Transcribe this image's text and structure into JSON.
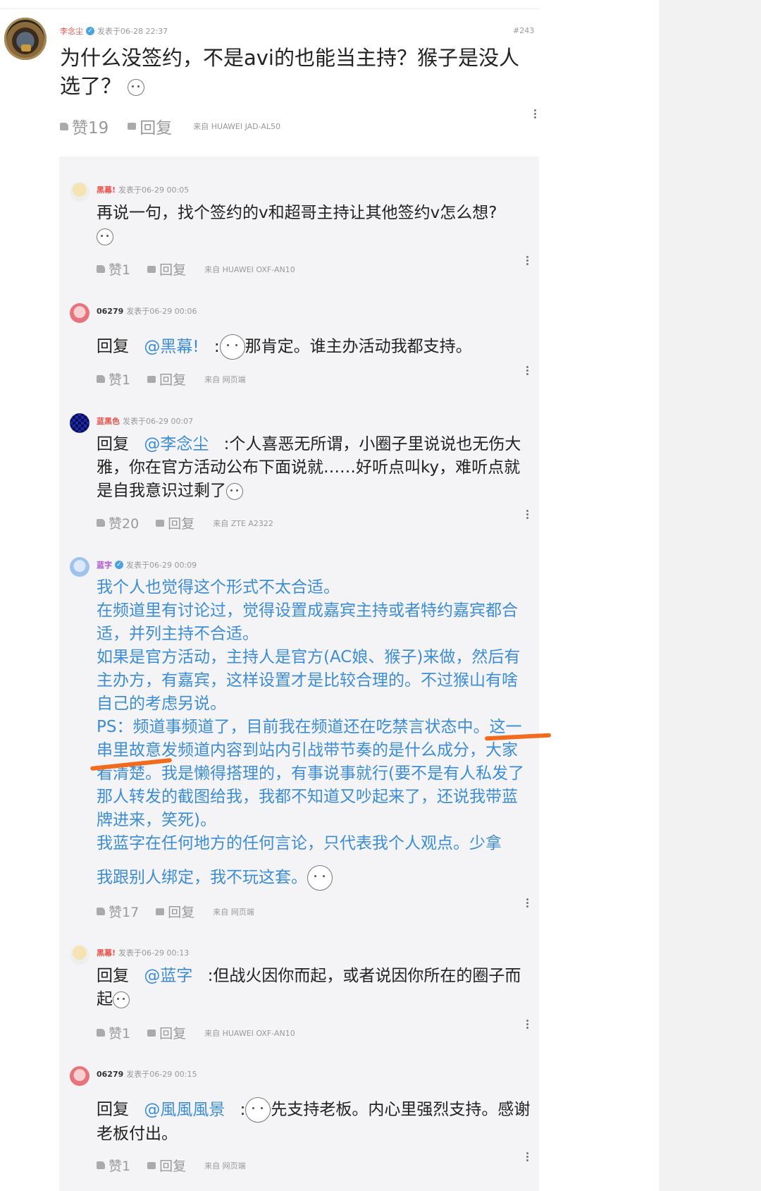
{
  "main_post": {
    "username": "李念尘",
    "time": "发表于06-28  22:37",
    "floor": "#243",
    "content": "为什么没签约，不是avi的也能当主持？猴子是没人选了？",
    "likes": "赞19",
    "reply_label": "回复",
    "source": "来自 HUAWEI  JAD-AL50"
  },
  "replies": [
    {
      "username": "黑幕!",
      "time": "发表于06-29  00:05",
      "content": "再说一句，找个签约的v和超哥主持让其他签约v怎么想?",
      "likes": "赞1",
      "reply_label": "回复",
      "source": "来自 HUAWEI  OXF-AN10"
    },
    {
      "username": "06279",
      "time": "发表于06-29  00:06",
      "prefix": "回复",
      "mention": "@黑幕!",
      "colon": ":",
      "content": "那肯定。谁主办活动我都支持。",
      "likes": "赞1",
      "reply_label": "回复",
      "source": "来自 网页端"
    },
    {
      "username": "蓝黑色",
      "time": "发表于06-29  00:07",
      "prefix": "回复",
      "mention": "@李念尘",
      "colon": ":",
      "content": "个人喜恶无所谓，小圈子里说说也无伤大雅，你在官方活动公布下面说就……好听点叫ky，难听点就是自我意识过剩了",
      "likes": "赞20",
      "reply_label": "回复",
      "source": "来自 ZTE  A2322"
    },
    {
      "username": "蓝字",
      "time": "发表于06-29  00:09",
      "content_lines": [
        "我个人也觉得这个形式不太合适。",
        "在频道里有讨论过，觉得设置成嘉宾主持或者特约嘉宾都合适，并列主持不合适。",
        "如果是官方活动，主持人是官方(AC娘、猴子)来做，然后有主办方，有嘉宾，这样设置才是比较合理的。不过猴山有啥自己的考虑另说。",
        "PS：频道事频道了，目前我在频道还在吃禁言状态中。这一串里故意发频道内容到站内引战带节奏的是什么成分，大家看清楚。我是懒得搭理的，有事说事就行(要不是有人私发了那人转发的截图给我，我都不知道又吵起来了，还说我带蓝牌进来，笑死)。",
        "我蓝字在任何地方的任何言论，只代表我个人观点。少拿",
        "我跟别人绑定，我不玩这套。"
      ],
      "likes": "赞17",
      "reply_label": "回复",
      "source": "来自 网页端"
    },
    {
      "username": "黑幕!",
      "time": "发表于06-29  00:13",
      "prefix": "回复",
      "mention": "@蓝字",
      "colon": ":",
      "content": "但战火因你而起，或者说因你所在的圈子而起",
      "likes": "赞1",
      "reply_label": "回复",
      "source": "来自 HUAWEI  OXF-AN10"
    },
    {
      "username": "06279",
      "time": "发表于06-29  00:15",
      "prefix": "回复",
      "mention": "@風風風景",
      "colon": ":",
      "content": "先支持老板。内心里强烈支持。感谢老板付出。",
      "likes": "赞1",
      "reply_label": "回复",
      "source": "来自 网页端"
    }
  ],
  "colors": {
    "mention": "#3c8dd6",
    "username_red": "#e8534b",
    "username_purple": "#a855d8",
    "highlight": "#f26a1b"
  },
  "icons": [
    "thumbs-up-icon",
    "comment-icon",
    "more-options-icon",
    "verified-icon",
    "sticker-emoji-icon"
  ]
}
